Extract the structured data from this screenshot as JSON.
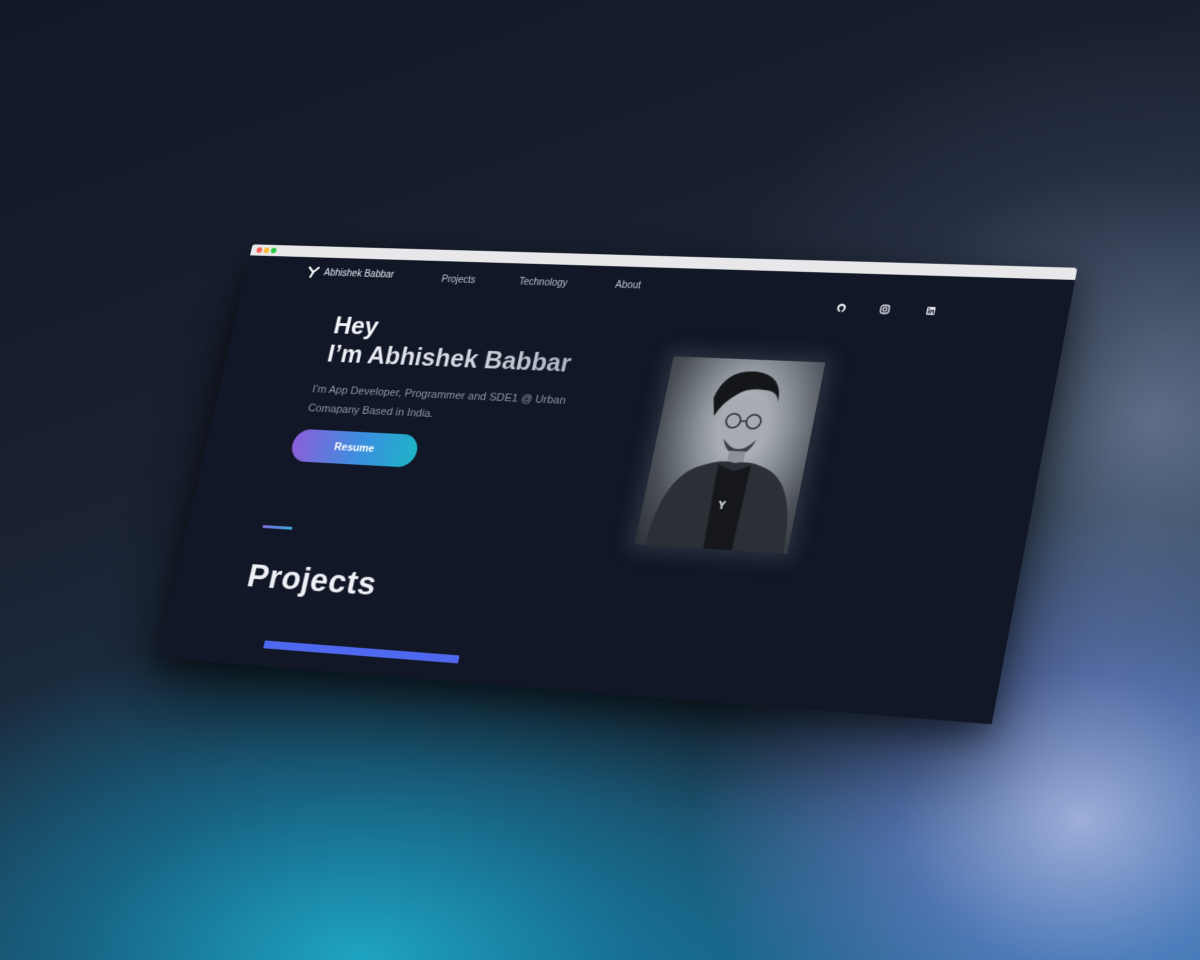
{
  "window": {
    "controls": [
      "close",
      "minimize",
      "maximize"
    ]
  },
  "nav": {
    "brand": "Abhishek Babbar",
    "brand_icon": "y-logo-icon",
    "links": [
      "Projects",
      "Technology",
      "About"
    ],
    "socials": [
      "github-icon",
      "instagram-icon",
      "linkedin-icon"
    ]
  },
  "hero": {
    "greeting": "Hey",
    "name_line": "I’m Abhishek Babbar",
    "subtitle": "I’m App Developer, Programmer and SDE1 @ Urban Comapany Based in India.",
    "resume_label": "Resume"
  },
  "projects": {
    "heading": "Projects"
  },
  "colors": {
    "page_bg": "#111726",
    "accent_blue": "#4f68f0",
    "button_gradient_start": "#8b5fd9",
    "button_gradient_end": "#1fb3c7"
  }
}
